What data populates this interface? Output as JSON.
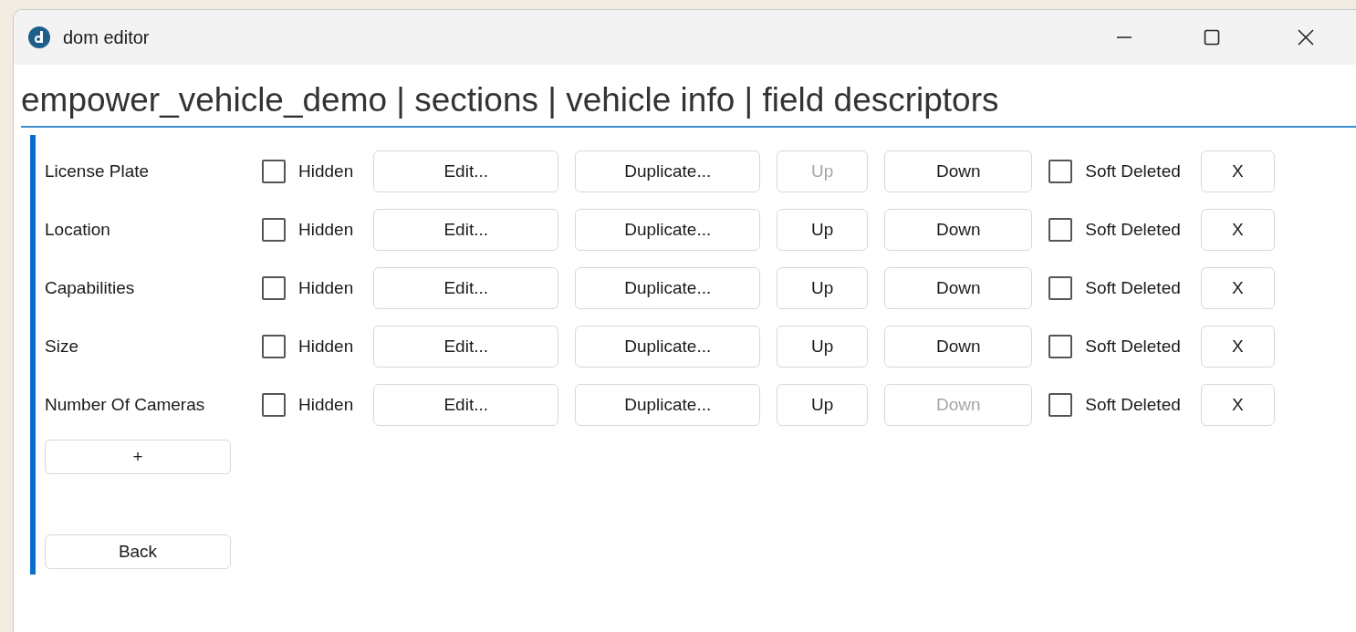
{
  "window": {
    "title": "dom editor"
  },
  "breadcrumb": "empower_vehicle_demo | sections | vehicle info | field descriptors",
  "rows": [
    {
      "name": "License Plate",
      "hidden": {
        "label": "Hidden",
        "checked": false
      },
      "edit": {
        "label": "Edit...",
        "disabled": false
      },
      "duplicate": {
        "label": "Duplicate...",
        "disabled": false
      },
      "up": {
        "label": "Up",
        "disabled": true
      },
      "down": {
        "label": "Down",
        "disabled": false
      },
      "soft_deleted": {
        "label": "Soft Deleted",
        "checked": false
      },
      "delete": {
        "label": "X",
        "disabled": false
      }
    },
    {
      "name": "Location",
      "hidden": {
        "label": "Hidden",
        "checked": false
      },
      "edit": {
        "label": "Edit...",
        "disabled": false
      },
      "duplicate": {
        "label": "Duplicate...",
        "disabled": false
      },
      "up": {
        "label": "Up",
        "disabled": false
      },
      "down": {
        "label": "Down",
        "disabled": false
      },
      "soft_deleted": {
        "label": "Soft Deleted",
        "checked": false
      },
      "delete": {
        "label": "X",
        "disabled": false
      }
    },
    {
      "name": "Capabilities",
      "hidden": {
        "label": "Hidden",
        "checked": false
      },
      "edit": {
        "label": "Edit...",
        "disabled": false
      },
      "duplicate": {
        "label": "Duplicate...",
        "disabled": false
      },
      "up": {
        "label": "Up",
        "disabled": false
      },
      "down": {
        "label": "Down",
        "disabled": false
      },
      "soft_deleted": {
        "label": "Soft Deleted",
        "checked": false
      },
      "delete": {
        "label": "X",
        "disabled": false
      }
    },
    {
      "name": "Size",
      "hidden": {
        "label": "Hidden",
        "checked": false
      },
      "edit": {
        "label": "Edit...",
        "disabled": false
      },
      "duplicate": {
        "label": "Duplicate...",
        "disabled": false
      },
      "up": {
        "label": "Up",
        "disabled": false
      },
      "down": {
        "label": "Down",
        "disabled": false
      },
      "soft_deleted": {
        "label": "Soft Deleted",
        "checked": false
      },
      "delete": {
        "label": "X",
        "disabled": false
      }
    },
    {
      "name": "Number Of Cameras",
      "hidden": {
        "label": "Hidden",
        "checked": false
      },
      "edit": {
        "label": "Edit...",
        "disabled": false
      },
      "duplicate": {
        "label": "Duplicate...",
        "disabled": false
      },
      "up": {
        "label": "Up",
        "disabled": false
      },
      "down": {
        "label": "Down",
        "disabled": true
      },
      "soft_deleted": {
        "label": "Soft Deleted",
        "checked": false
      },
      "delete": {
        "label": "X",
        "disabled": false
      }
    }
  ],
  "add_button": "+",
  "back_button": "Back"
}
